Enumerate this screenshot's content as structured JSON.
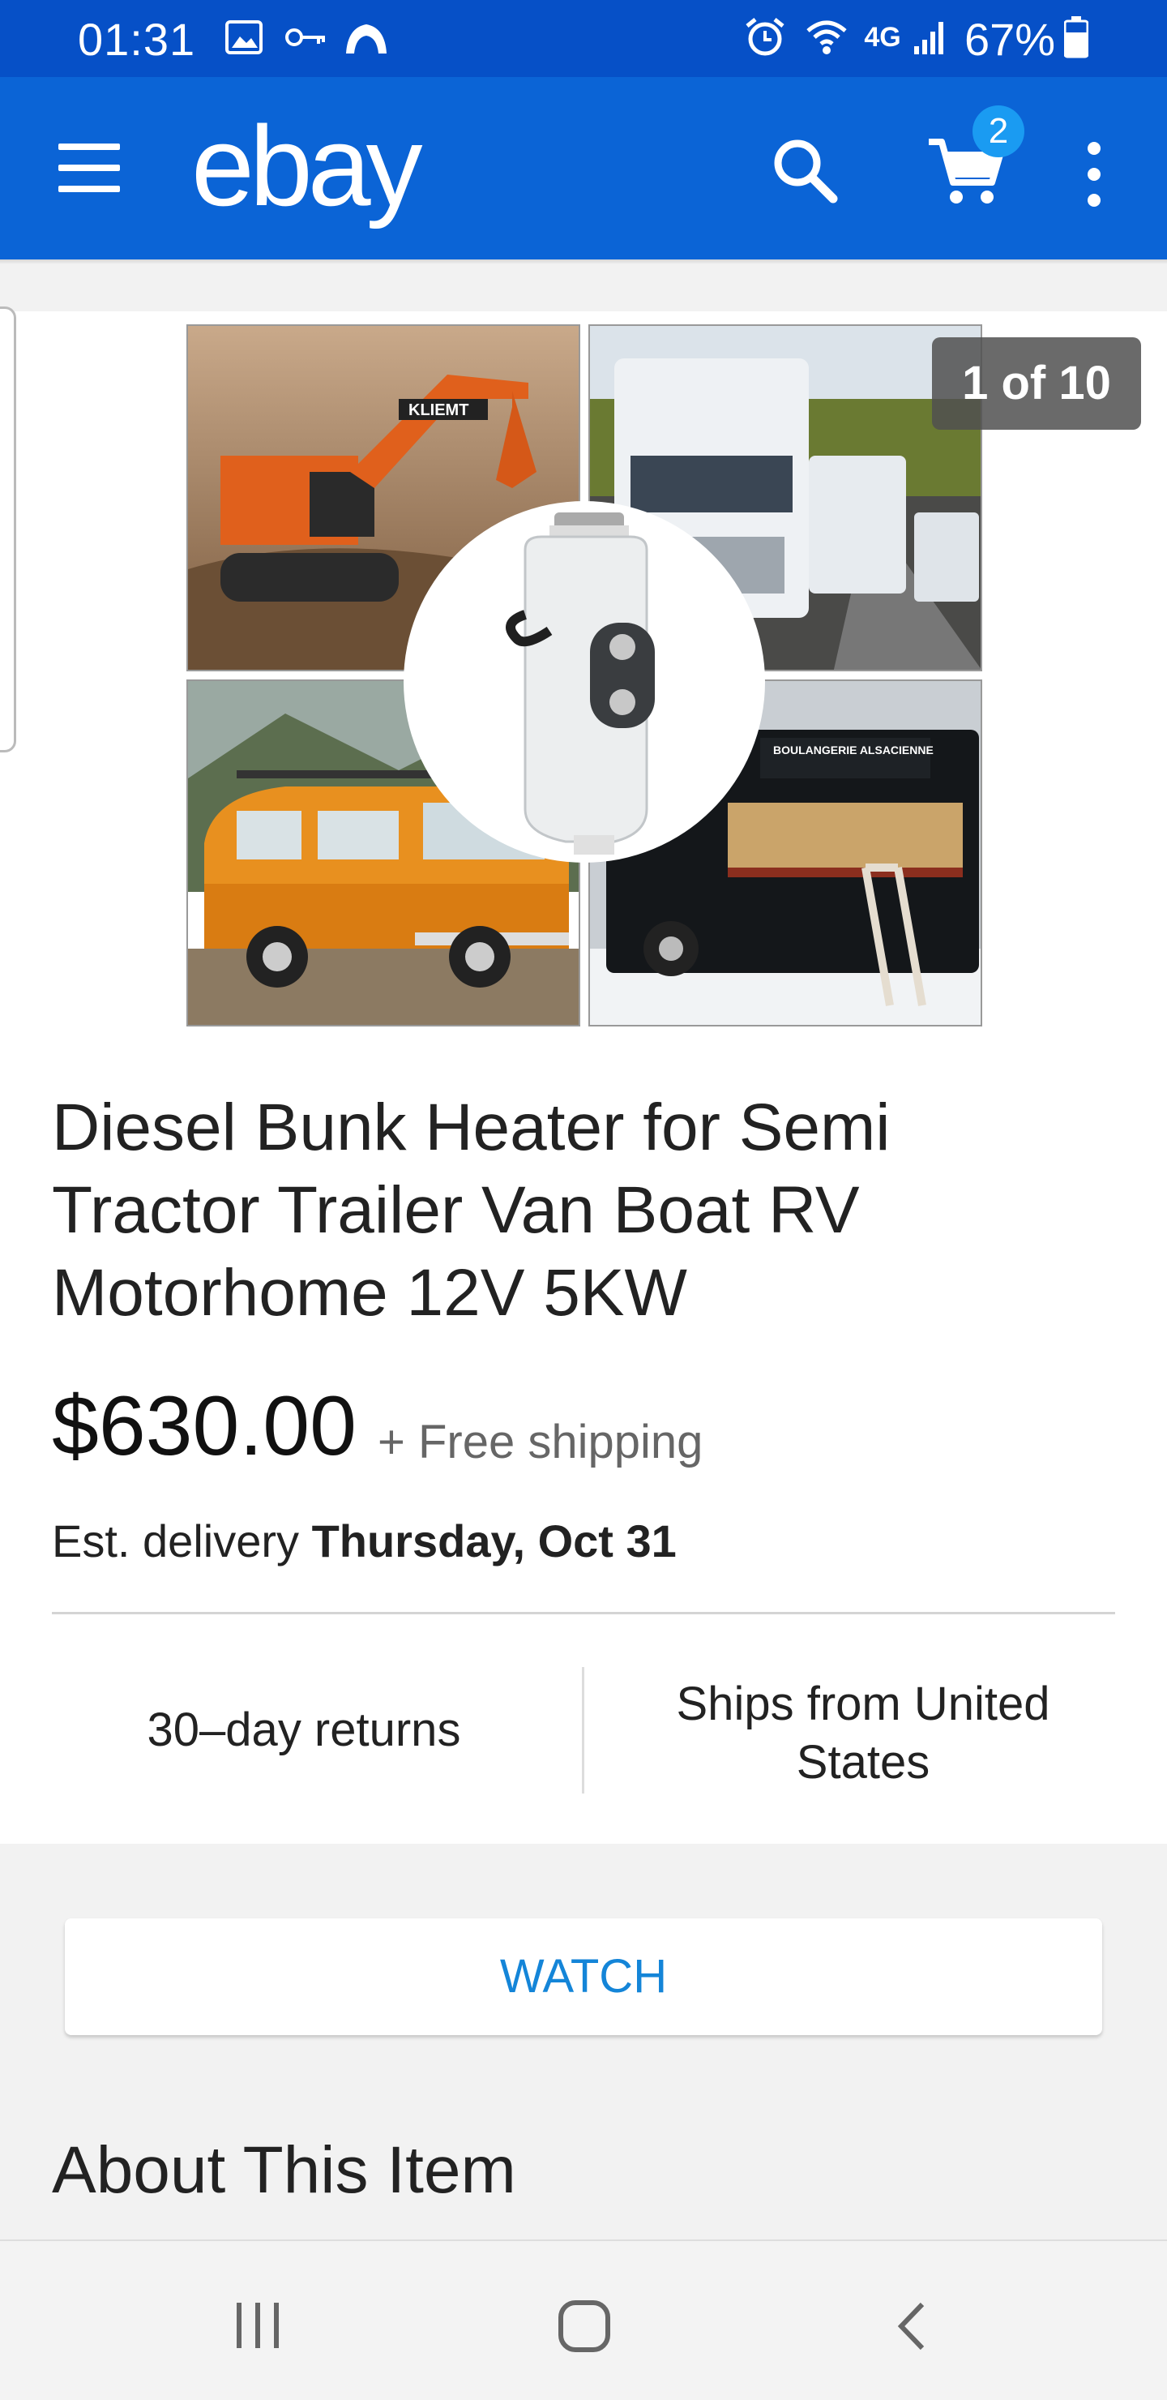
{
  "status_bar": {
    "time": "01:31",
    "icons": [
      "image-icon",
      "key-icon",
      "cloud-icon",
      "alarm-icon",
      "wifi-icon",
      "4g-icon",
      "signal-icon",
      "battery-icon"
    ],
    "battery": "67%"
  },
  "app_bar": {
    "logo": "ebay",
    "cart_count": "2",
    "accent": "#0b64d6"
  },
  "gallery": {
    "counter": "1 of 10",
    "images": [
      "excavator-photo",
      "semi-trucks-photo",
      "orange-van-photo",
      "food-truck-photo",
      "heater-product-photo"
    ],
    "food_truck_sign": "BOULANGERIE ALSACIENNE",
    "excavator_label": "KLIEMT"
  },
  "listing": {
    "title": "Diesel Bunk Heater for Semi Tractor Trailer Van Boat RV Motorhome 12V 5KW",
    "price": "$630.00",
    "shipping": "+ Free shipping",
    "delivery_prefix": "Est. delivery",
    "delivery_date": "Thursday, Oct 31",
    "returns": "30–day returns",
    "ships_from": "Ships from United States"
  },
  "actions": {
    "watch_label": "WATCH"
  },
  "sections": {
    "about_heading": "About This Item"
  },
  "nav_bar": {
    "buttons": [
      "recents-icon",
      "home-icon",
      "back-icon"
    ]
  }
}
